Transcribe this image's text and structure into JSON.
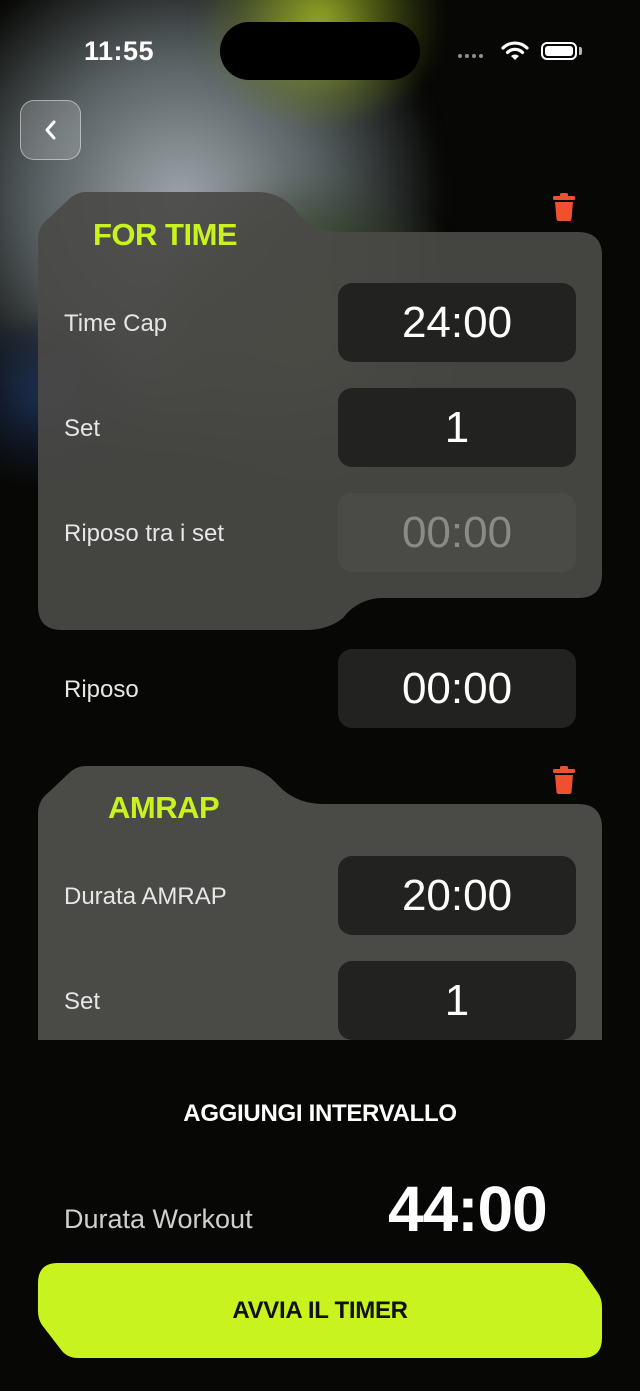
{
  "status_bar": {
    "time": "11:55"
  },
  "intervals": [
    {
      "title": "FOR TIME",
      "rows": [
        {
          "label": "Time Cap",
          "value": "24:00"
        },
        {
          "label": "Set",
          "value": "1"
        },
        {
          "label": "Riposo tra i set",
          "value": "00:00"
        }
      ]
    },
    {
      "title": "AMRAP",
      "rows": [
        {
          "label": "Durata AMRAP",
          "value": "20:00"
        },
        {
          "label": "Set",
          "value": "1"
        }
      ]
    }
  ],
  "rest": {
    "label": "Riposo",
    "value": "00:00"
  },
  "add_interval_label": "AGGIUNGI INTERVALLO",
  "workout_duration": {
    "label": "Durata Workout",
    "value": "44:00"
  },
  "start_button_label": "AVVIA IL TIMER",
  "colors": {
    "accent": "#c9f31f",
    "delete": "#f0502e",
    "card": "#4a4a46",
    "field": "#222220"
  },
  "icons": {
    "back": "chevron-left-icon",
    "delete": "trash-icon"
  }
}
